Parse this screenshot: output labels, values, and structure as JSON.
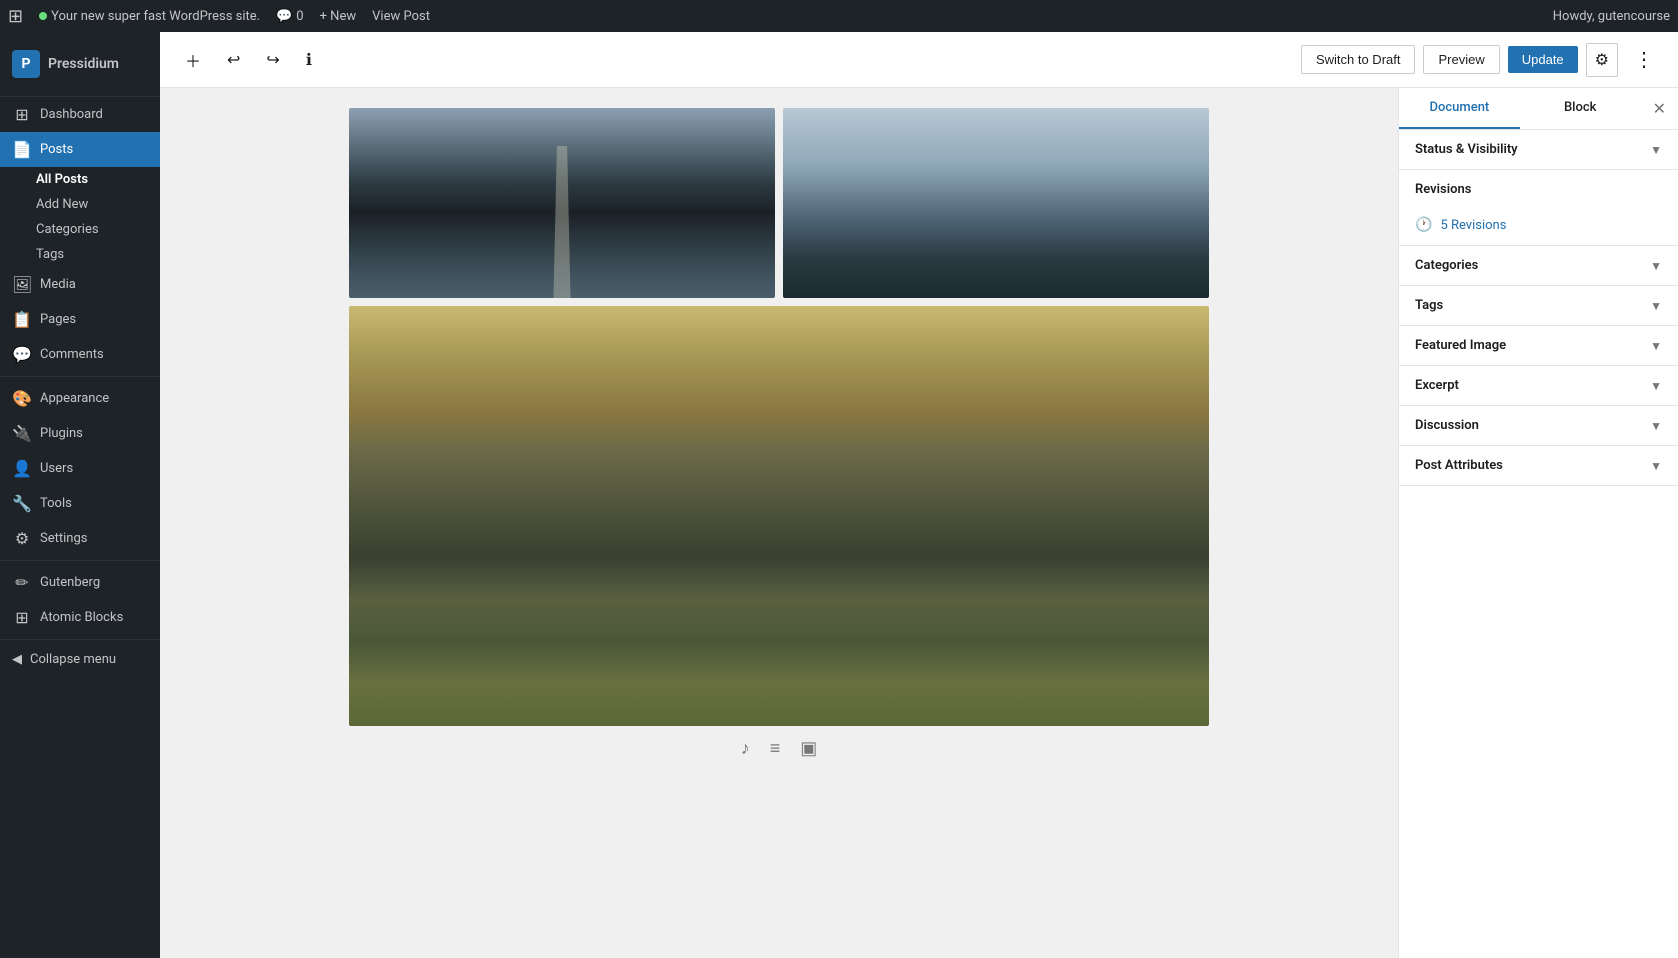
{
  "adminbar": {
    "logo": "W",
    "site_name": "Your new super fast WordPress site.",
    "comments_label": "Comments",
    "comments_count": "0",
    "new_label": "+ New",
    "view_post_label": "View Post",
    "howdy": "Howdy, gutencourse"
  },
  "sidebar": {
    "brand": "Pressidium",
    "items": [
      {
        "id": "dashboard",
        "label": "Dashboard",
        "icon": "⊞"
      },
      {
        "id": "posts",
        "label": "Posts",
        "icon": "📄",
        "active": true
      },
      {
        "id": "media",
        "label": "Media",
        "icon": "🖼"
      },
      {
        "id": "pages",
        "label": "Pages",
        "icon": "📋"
      },
      {
        "id": "comments",
        "label": "Comments",
        "icon": "💬"
      },
      {
        "id": "appearance",
        "label": "Appearance",
        "icon": "🎨"
      },
      {
        "id": "plugins",
        "label": "Plugins",
        "icon": "🔌"
      },
      {
        "id": "users",
        "label": "Users",
        "icon": "👤"
      },
      {
        "id": "tools",
        "label": "Tools",
        "icon": "🔧"
      },
      {
        "id": "settings",
        "label": "Settings",
        "icon": "⚙"
      },
      {
        "id": "gutenberg",
        "label": "Gutenberg",
        "icon": "✏"
      },
      {
        "id": "atomic-blocks",
        "label": "Atomic Blocks",
        "icon": "⊞"
      }
    ],
    "posts_subitems": [
      {
        "id": "all-posts",
        "label": "All Posts",
        "active": true
      },
      {
        "id": "add-new",
        "label": "Add New"
      },
      {
        "id": "categories",
        "label": "Categories"
      },
      {
        "id": "tags",
        "label": "Tags"
      }
    ],
    "collapse_label": "Collapse menu"
  },
  "toolbar": {
    "add_block_title": "Add block",
    "undo_title": "Undo",
    "redo_title": "Redo",
    "info_title": "View post details",
    "switch_draft_label": "Switch to Draft",
    "preview_label": "Preview",
    "update_label": "Update",
    "settings_title": "Settings",
    "more_title": "More tools & options"
  },
  "panel": {
    "document_tab": "Document",
    "block_tab": "Block",
    "close_title": "Close settings",
    "sections": [
      {
        "id": "status-visibility",
        "label": "Status & Visibility",
        "open": true
      },
      {
        "id": "revisions",
        "label": "Revisions",
        "count": 5,
        "open": false
      },
      {
        "id": "categories",
        "label": "Categories",
        "open": false
      },
      {
        "id": "tags",
        "label": "Tags",
        "open": false
      },
      {
        "id": "featured-image",
        "label": "Featured Image",
        "open": false
      },
      {
        "id": "excerpt",
        "label": "Excerpt",
        "open": false
      },
      {
        "id": "discussion",
        "label": "Discussion",
        "open": false
      },
      {
        "id": "post-attributes",
        "label": "Post Attributes",
        "open": false
      }
    ],
    "revisions_label": "5 Revisions",
    "revisions_icon": "🕐"
  },
  "editor": {
    "block_controls": [
      {
        "id": "audio",
        "icon": "♪"
      },
      {
        "id": "list",
        "icon": "≡"
      },
      {
        "id": "image",
        "icon": "▣"
      }
    ]
  }
}
